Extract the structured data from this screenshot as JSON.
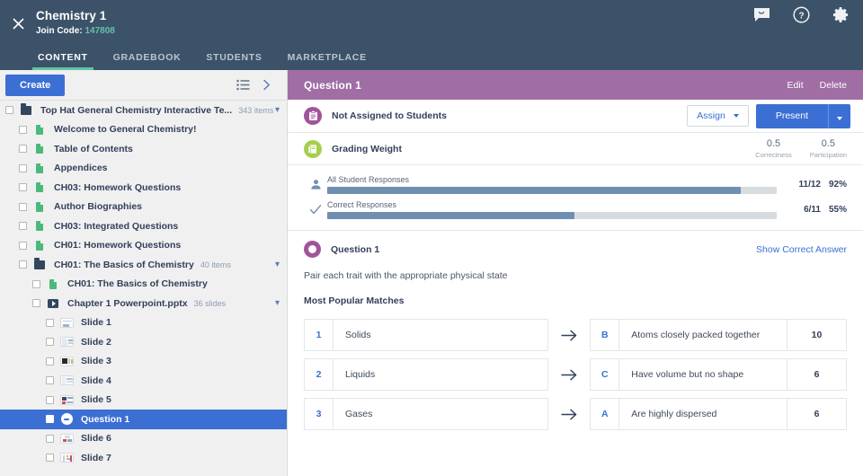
{
  "topbar": {
    "close_icon": "close-icon",
    "course_title": "Chemistry 1",
    "join_label": "Join Code:",
    "join_code": "147808",
    "icons": [
      {
        "name": "messages-icon"
      },
      {
        "name": "help-icon"
      },
      {
        "name": "settings-gear-icon"
      }
    ],
    "tabs": [
      {
        "label": "CONTENT",
        "active": true
      },
      {
        "label": "GRADEBOOK",
        "active": false
      },
      {
        "label": "STUDENTS",
        "active": false
      },
      {
        "label": "MARKETPLACE",
        "active": false
      }
    ]
  },
  "sidebar": {
    "create_label": "Create",
    "list_view_icon": "list-view-icon",
    "collapse_icon": "chevron-right-icon",
    "tree": [
      {
        "label": "Top Hat General Chemistry Interactive Te...",
        "icon": "folder",
        "count": "343 items",
        "indent": 0,
        "chevron": "down",
        "selected": false
      },
      {
        "label": "Welcome to General Chemistry!",
        "icon": "page",
        "count": "",
        "indent": 1,
        "chevron": "",
        "selected": false
      },
      {
        "label": "Table of Contents",
        "icon": "page",
        "count": "",
        "indent": 1,
        "chevron": "",
        "selected": false
      },
      {
        "label": "Appendices",
        "icon": "page",
        "count": "",
        "indent": 1,
        "chevron": "",
        "selected": false
      },
      {
        "label": "CH03: Homework Questions",
        "icon": "page",
        "count": "",
        "indent": 1,
        "chevron": "",
        "selected": false
      },
      {
        "label": "Author Biographies",
        "icon": "page",
        "count": "",
        "indent": 1,
        "chevron": "",
        "selected": false
      },
      {
        "label": "CH03: Integrated Questions",
        "icon": "page",
        "count": "",
        "indent": 1,
        "chevron": "",
        "selected": false
      },
      {
        "label": "CH01: Homework Questions",
        "icon": "page",
        "count": "",
        "indent": 1,
        "chevron": "",
        "selected": false
      },
      {
        "label": "CH01: The Basics of Chemistry",
        "icon": "folder",
        "count": "40 items",
        "indent": 1,
        "chevron": "down",
        "selected": false
      },
      {
        "label": "CH01: The Basics of Chemistry",
        "icon": "page",
        "count": "",
        "indent": 2,
        "chevron": "",
        "selected": false
      },
      {
        "label": "Chapter 1 Powerpoint.pptx",
        "icon": "ppt",
        "count": "36 slides",
        "indent": 2,
        "chevron": "down",
        "selected": false
      },
      {
        "label": "Slide 1",
        "icon": "thumb",
        "count": "",
        "indent": 3,
        "chevron": "",
        "selected": false
      },
      {
        "label": "Slide 2",
        "icon": "thumb",
        "count": "",
        "indent": 3,
        "chevron": "",
        "selected": false
      },
      {
        "label": "Slide 3",
        "icon": "thumb",
        "count": "",
        "indent": 3,
        "chevron": "",
        "selected": false
      },
      {
        "label": "Slide 4",
        "icon": "thumb",
        "count": "",
        "indent": 3,
        "chevron": "",
        "selected": false
      },
      {
        "label": "Slide 5",
        "icon": "thumb",
        "count": "",
        "indent": 3,
        "chevron": "",
        "selected": false
      },
      {
        "label": "Question 1",
        "icon": "question",
        "count": "",
        "indent": 3,
        "chevron": "",
        "selected": true
      },
      {
        "label": "Slide 6",
        "icon": "thumb",
        "count": "",
        "indent": 3,
        "chevron": "",
        "selected": false
      },
      {
        "label": "Slide 7",
        "icon": "thumb",
        "count": "",
        "indent": 3,
        "chevron": "",
        "selected": false
      }
    ]
  },
  "panel": {
    "title": "Question 1",
    "edit_label": "Edit",
    "delete_label": "Delete",
    "assign_status": "Not Assigned to Students",
    "assign_status_icon": "clipboard-icon",
    "assign_button": "Assign",
    "present_button": "Present",
    "grading": {
      "label": "Grading Weight",
      "icon": "book-icon",
      "weights": [
        {
          "value": "0.5",
          "label": "Correctness"
        },
        {
          "value": "0.5",
          "label": "Participation"
        }
      ]
    },
    "bars": [
      {
        "icon": "person-icon",
        "caption": "All Student Responses",
        "fraction": "11/12",
        "percent": "92%",
        "fill": 92
      },
      {
        "icon": "check-icon",
        "caption": "Correct Responses",
        "fraction": "6/11",
        "percent": "55%",
        "fill": 55
      }
    ],
    "question": {
      "heading": "Question 1",
      "show_answer_link": "Show Correct Answer",
      "prompt": "Pair each trait with the appropriate physical state",
      "matches_heading": "Most Popular Matches",
      "matches": [
        {
          "num": "1",
          "term": "Solids",
          "key": "B",
          "definition": "Atoms closely packed together",
          "count": "10"
        },
        {
          "num": "2",
          "term": "Liquids",
          "key": "C",
          "definition": "Have volume but no shape",
          "count": "6"
        },
        {
          "num": "3",
          "term": "Gases",
          "key": "A",
          "definition": "Are highly dispersed",
          "count": "6"
        }
      ]
    }
  }
}
